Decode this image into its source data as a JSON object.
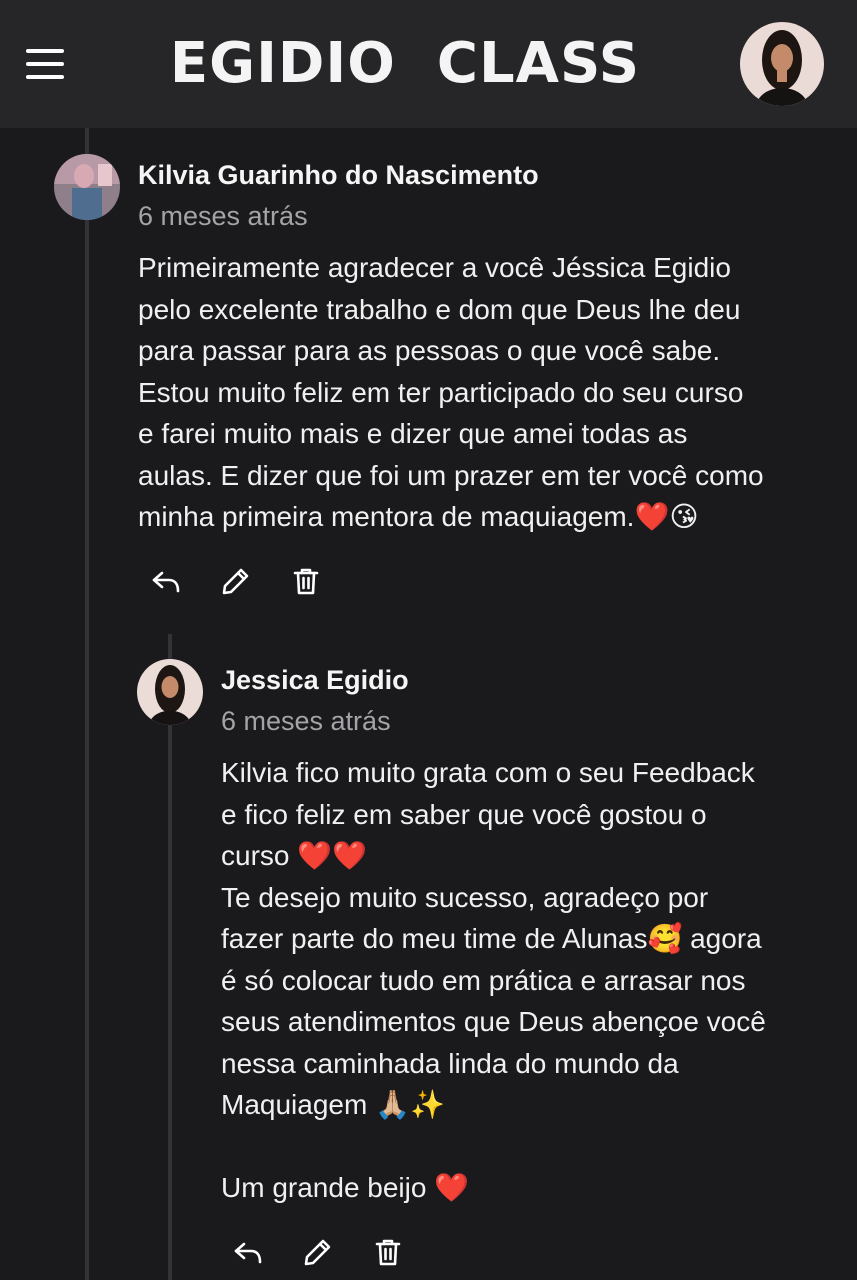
{
  "header": {
    "logo": "EGIDIO  CLASS",
    "menu_icon": "hamburger-menu-icon",
    "avatar_icon": "user-avatar"
  },
  "comments": [
    {
      "author": "Kilvia Guarinho do Nascimento",
      "time": "6 meses atrás",
      "text": "Primeiramente agradecer a você Jéssica Egidio\npelo excelente trabalho e dom que Deus lhe deu\npara passar para as pessoas o que você sabe.\nEstou muito feliz em ter participado do seu curso\ne farei muito mais e dizer que amei todas as\naulas. E dizer que foi um prazer em ter você como\nminha primeira mentora de maquiagem.❤️😘"
    },
    {
      "author": "Jessica Egidio",
      "time": "6 meses atrás",
      "text": "Kilvia fico muito grata com o seu Feedback\ne fico feliz em saber que você gostou o\ncurso ❤️❤️\nTe desejo muito sucesso, agradeço por\nfazer parte do meu time de Alunas🥰 agora\né só colocar tudo em prática e arrasar nos\nseus atendimentos que Deus abençoe você\nnessa caminhada linda do mundo da\nMaquiagem 🙏🏼✨\n\nUm grande beijo ❤️"
    }
  ],
  "actions": {
    "reply_icon": "reply-icon",
    "edit_icon": "pencil-icon",
    "delete_icon": "trash-icon"
  },
  "colors": {
    "background": "#1a1a1d",
    "header": "#262628",
    "text": "#f0f0f0",
    "muted": "#a4a4a8",
    "thread_line": "#333336"
  }
}
